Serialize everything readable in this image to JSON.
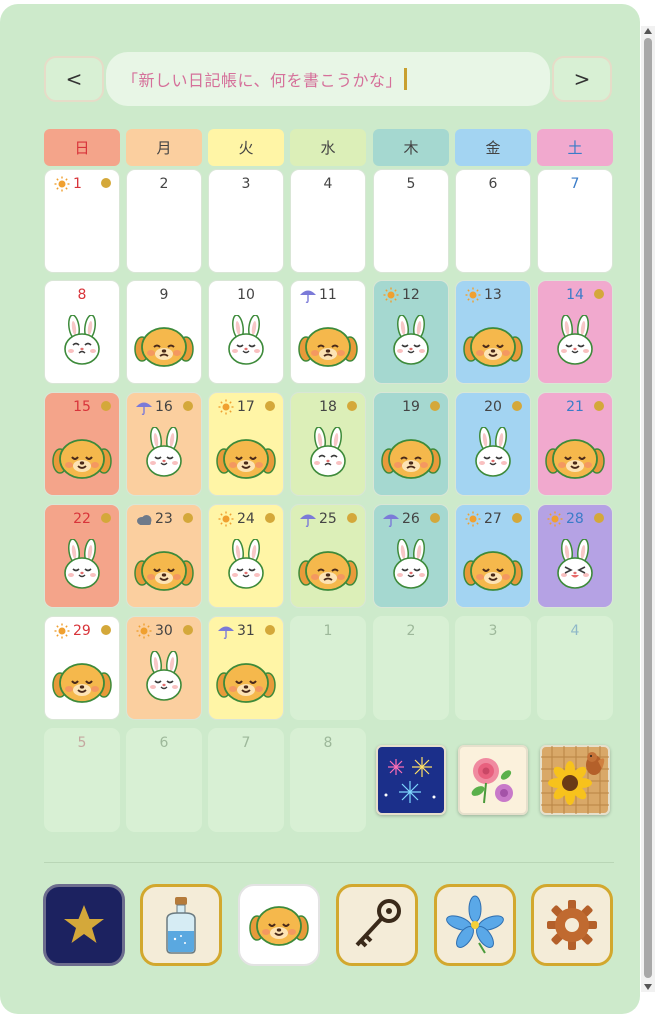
{
  "diary_prompt": "「新しい日記帳に、何を書こうかな」",
  "nav": {
    "prev_label": "<",
    "next_label": ">"
  },
  "weekdays": [
    {
      "label": "日",
      "bg": "#f4a48a",
      "color": "#d8343a"
    },
    {
      "label": "月",
      "bg": "#fbcf9f",
      "color": "#444444"
    },
    {
      "label": "火",
      "bg": "#fff5a6",
      "color": "#444444"
    },
    {
      "label": "水",
      "bg": "#dcefb8",
      "color": "#444444"
    },
    {
      "label": "木",
      "bg": "#a5d8d0",
      "color": "#444444"
    },
    {
      "label": "金",
      "bg": "#a3d4f2",
      "color": "#444444"
    },
    {
      "label": "土",
      "bg": "#f1a9ce",
      "color": "#3a7cc8"
    }
  ],
  "days": [
    {
      "n": "1",
      "bg": "#ffffff",
      "color": "#d8343a",
      "weather": "sun",
      "dot": true,
      "mood": ""
    },
    {
      "n": "2",
      "bg": "#ffffff",
      "color": "#444444",
      "weather": "",
      "dot": false,
      "mood": ""
    },
    {
      "n": "3",
      "bg": "#ffffff",
      "color": "#444444",
      "weather": "",
      "dot": false,
      "mood": ""
    },
    {
      "n": "4",
      "bg": "#ffffff",
      "color": "#444444",
      "weather": "",
      "dot": false,
      "mood": ""
    },
    {
      "n": "5",
      "bg": "#ffffff",
      "color": "#444444",
      "weather": "",
      "dot": false,
      "mood": ""
    },
    {
      "n": "6",
      "bg": "#ffffff",
      "color": "#444444",
      "weather": "",
      "dot": false,
      "mood": ""
    },
    {
      "n": "7",
      "bg": "#ffffff",
      "color": "#3a7cc8",
      "weather": "",
      "dot": false,
      "mood": ""
    },
    {
      "n": "8",
      "bg": "#ffffff",
      "color": "#d8343a",
      "weather": "",
      "dot": false,
      "mood": "bunny-sad"
    },
    {
      "n": "9",
      "bg": "#ffffff",
      "color": "#444444",
      "weather": "",
      "dot": false,
      "mood": "dog-sad"
    },
    {
      "n": "10",
      "bg": "#ffffff",
      "color": "#444444",
      "weather": "",
      "dot": false,
      "mood": "bunny-happy"
    },
    {
      "n": "11",
      "bg": "#ffffff",
      "color": "#444444",
      "weather": "rain",
      "dot": false,
      "mood": "dog-sad"
    },
    {
      "n": "12",
      "bg": "#a5d8d0",
      "color": "#444444",
      "weather": "sun",
      "dot": false,
      "mood": "bunny-happy"
    },
    {
      "n": "13",
      "bg": "#a3d4f2",
      "color": "#444444",
      "weather": "sun",
      "dot": false,
      "mood": "dog-happy"
    },
    {
      "n": "14",
      "bg": "#f1a9ce",
      "color": "#3a7cc8",
      "weather": "",
      "dot": true,
      "mood": "bunny-happy"
    },
    {
      "n": "15",
      "bg": "#f4a48a",
      "color": "#d8343a",
      "weather": "",
      "dot": true,
      "mood": "dog-happy"
    },
    {
      "n": "16",
      "bg": "#fbcf9f",
      "color": "#444444",
      "weather": "rain",
      "dot": true,
      "mood": "bunny-happy"
    },
    {
      "n": "17",
      "bg": "#fff5a6",
      "color": "#444444",
      "weather": "sun",
      "dot": true,
      "mood": "dog-happy"
    },
    {
      "n": "18",
      "bg": "#dcefb8",
      "color": "#444444",
      "weather": "",
      "dot": true,
      "mood": "bunny-sad"
    },
    {
      "n": "19",
      "bg": "#a5d8d0",
      "color": "#444444",
      "weather": "",
      "dot": true,
      "mood": "dog-sad"
    },
    {
      "n": "20",
      "bg": "#a3d4f2",
      "color": "#444444",
      "weather": "",
      "dot": true,
      "mood": "bunny-happy"
    },
    {
      "n": "21",
      "bg": "#f1a9ce",
      "color": "#3a7cc8",
      "weather": "",
      "dot": true,
      "mood": "dog-happy"
    },
    {
      "n": "22",
      "bg": "#f4a48a",
      "color": "#d8343a",
      "weather": "",
      "dot": true,
      "mood": "bunny-happy"
    },
    {
      "n": "23",
      "bg": "#fbcf9f",
      "color": "#444444",
      "weather": "cloud",
      "dot": true,
      "mood": "dog-happy"
    },
    {
      "n": "24",
      "bg": "#fff5a6",
      "color": "#444444",
      "weather": "sun",
      "dot": true,
      "mood": "bunny-happy"
    },
    {
      "n": "25",
      "bg": "#dcefb8",
      "color": "#444444",
      "weather": "rain",
      "dot": true,
      "mood": "dog-sad"
    },
    {
      "n": "26",
      "bg": "#a5d8d0",
      "color": "#444444",
      "weather": "rain",
      "dot": true,
      "mood": "bunny-happy"
    },
    {
      "n": "27",
      "bg": "#a3d4f2",
      "color": "#444444",
      "weather": "sun",
      "dot": true,
      "mood": "dog-happy"
    },
    {
      "n": "28",
      "bg": "#b5a2e4",
      "color": "#3a7cc8",
      "weather": "sun",
      "dot": true,
      "mood": "bunny-laugh"
    },
    {
      "n": "29",
      "bg": "#ffffff",
      "color": "#d8343a",
      "weather": "sun",
      "dot": true,
      "mood": "dog-happy"
    },
    {
      "n": "30",
      "bg": "#fbcf9f",
      "color": "#444444",
      "weather": "sun",
      "dot": true,
      "mood": "bunny-happy"
    },
    {
      "n": "31",
      "bg": "#fff5a6",
      "color": "#444444",
      "weather": "rain",
      "dot": true,
      "mood": "dog-happy"
    },
    {
      "n": "1",
      "bg": "#d8f0d4",
      "color": "#9db89a",
      "weather": "",
      "dot": false,
      "mood": ""
    },
    {
      "n": "2",
      "bg": "#d8f0d4",
      "color": "#9db89a",
      "weather": "",
      "dot": false,
      "mood": ""
    },
    {
      "n": "3",
      "bg": "#d8f0d4",
      "color": "#9db89a",
      "weather": "",
      "dot": false,
      "mood": ""
    },
    {
      "n": "4",
      "bg": "#d8f0d4",
      "color": "#8fb8c8",
      "weather": "",
      "dot": false,
      "mood": ""
    },
    {
      "n": "5",
      "bg": "#d8f0d4",
      "color": "#c4a8a0",
      "weather": "",
      "dot": false,
      "mood": ""
    },
    {
      "n": "6",
      "bg": "#d8f0d4",
      "color": "#9db89a",
      "weather": "",
      "dot": false,
      "mood": ""
    },
    {
      "n": "7",
      "bg": "#d8f0d4",
      "color": "#9db89a",
      "weather": "",
      "dot": false,
      "mood": ""
    },
    {
      "n": "8",
      "bg": "#d8f0d4",
      "color": "#9db89a",
      "weather": "",
      "dot": false,
      "mood": ""
    }
  ],
  "stickers": [
    "fireworks-sticker",
    "roses-sticker",
    "sunflower-squirrel-sticker"
  ],
  "item_bar": [
    {
      "name": "star-icon",
      "bg": "#1c2260",
      "border": "#6d6d8e"
    },
    {
      "name": "bottle-icon",
      "bg": "#f4ecd8",
      "border": "#d2a82e"
    },
    {
      "name": "dog-face-icon",
      "bg": "#ffffff",
      "border": "#ffffff"
    },
    {
      "name": "key-icon",
      "bg": "#f4ecd8",
      "border": "#d2a82e"
    },
    {
      "name": "lily-flower-icon",
      "bg": "#f4ecd8",
      "border": "#d2a82e"
    },
    {
      "name": "gear-icon",
      "bg": "#f4ecd8",
      "border": "#d2a82e"
    }
  ]
}
